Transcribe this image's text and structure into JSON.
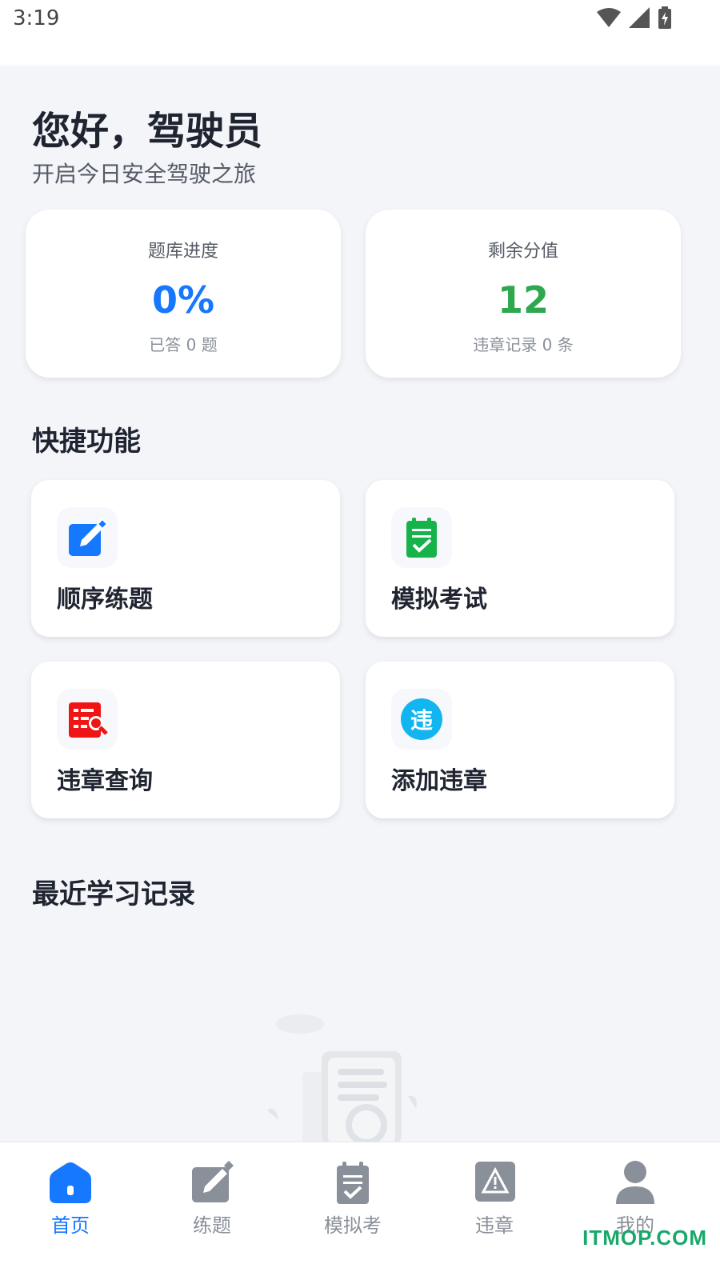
{
  "status_bar": {
    "time": "3:19"
  },
  "header": {
    "greeting": "您好，驾驶员",
    "subtitle": "开启今日安全驾驶之旅"
  },
  "stats": [
    {
      "label": "题库进度",
      "value": "0%",
      "sub": "已答 0 题",
      "color": "#1677ff"
    },
    {
      "label": "剩余分值",
      "value": "12",
      "sub": "违章记录 0 条",
      "color": "#2ea84f"
    }
  ],
  "quick_section": {
    "title": "快捷功能",
    "items": [
      {
        "label": "顺序练题",
        "icon": "edit-icon",
        "color": "#1677ff"
      },
      {
        "label": "模拟考试",
        "icon": "clipboard-check-icon",
        "color": "#16b24a"
      },
      {
        "label": "违章查询",
        "icon": "document-search-icon",
        "color": "#f01414"
      },
      {
        "label": "添加违章",
        "icon": "violation-badge-icon",
        "badge_text": "违",
        "color": "#12b5f0"
      }
    ]
  },
  "recent_section": {
    "title": "最近学习记录"
  },
  "tabbar": {
    "items": [
      {
        "label": "首页",
        "icon": "home-icon",
        "active": true
      },
      {
        "label": "练题",
        "icon": "edit-icon",
        "active": false
      },
      {
        "label": "模拟考",
        "icon": "clipboard-check-icon",
        "active": false
      },
      {
        "label": "违章",
        "icon": "warning-icon",
        "active": false
      },
      {
        "label": "我的",
        "icon": "user-icon",
        "active": false
      }
    ],
    "active_color": "#1677ff",
    "inactive_color": "#8a9099"
  },
  "watermark": "ITMOP.COM"
}
